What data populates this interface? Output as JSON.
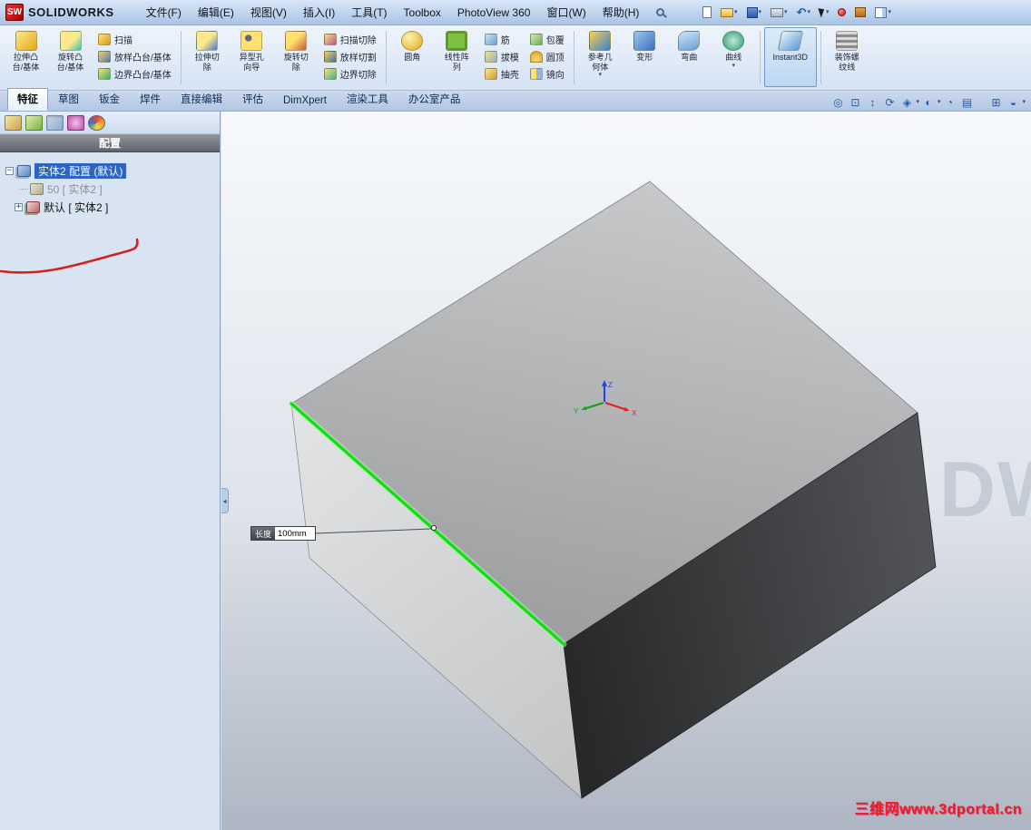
{
  "titlebar": {
    "logo": "SW",
    "brand": "SOLIDWORKS",
    "menus": [
      "文件(F)",
      "编辑(E)",
      "视图(V)",
      "插入(I)",
      "工具(T)",
      "Toolbox",
      "PhotoView 360",
      "窗口(W)",
      "帮助(H)"
    ]
  },
  "ribbon": {
    "big": [
      "拉伸凸\n台/基体",
      "旋转凸\n台/基体",
      "拉伸切\n除",
      "异型孔\n向导",
      "旋转切\n除",
      "圆角",
      "线性阵\n列",
      "参考几\n何体",
      "变形",
      "弯曲",
      "曲线",
      "Instant3D",
      "装饰螺\n纹线"
    ],
    "small": [
      "扫描",
      "放样凸台/基体",
      "边界凸台/基体",
      "扫描切除",
      "放样切割",
      "边界切除",
      "筋",
      "拔模",
      "抽壳",
      "包覆",
      "圆顶",
      "镜向"
    ]
  },
  "tabs": {
    "items": [
      "特征",
      "草图",
      "钣金",
      "焊件",
      "直接编辑",
      "评估",
      "DimXpert",
      "渲染工具",
      "办公室产品"
    ],
    "active": "特征"
  },
  "config_panel": {
    "header": "配置",
    "tree": {
      "root_label": "实体2 配置 (默认)",
      "child_dim": "50 [ 实体2 ]",
      "child_default": "默认 [ 实体2 ]"
    }
  },
  "viewport": {
    "dimension": {
      "label": "长度",
      "value": "100mm"
    },
    "triad": {
      "x": "X",
      "y": "Y",
      "z": "Z"
    },
    "watermark": "DW",
    "site_watermark": "三维网www.3dportal.cn"
  },
  "glyphs": {
    "caret": "▾",
    "minus": "−",
    "plus": "+",
    "undo": "↶",
    "splitter": "◂",
    "vb": [
      "◎",
      "⊡",
      "↕",
      "⟳",
      "◈",
      "◐",
      "◔",
      "▤",
      "⊞",
      "◒"
    ]
  },
  "colors": {
    "edge_highlight": "#0ee00e",
    "selection_blue": "#2f63c4",
    "annotation_red": "#d42020",
    "face_dark": "#2e2f31",
    "face_top": "#b0b1b3",
    "face_left": "#d6d8d9"
  }
}
